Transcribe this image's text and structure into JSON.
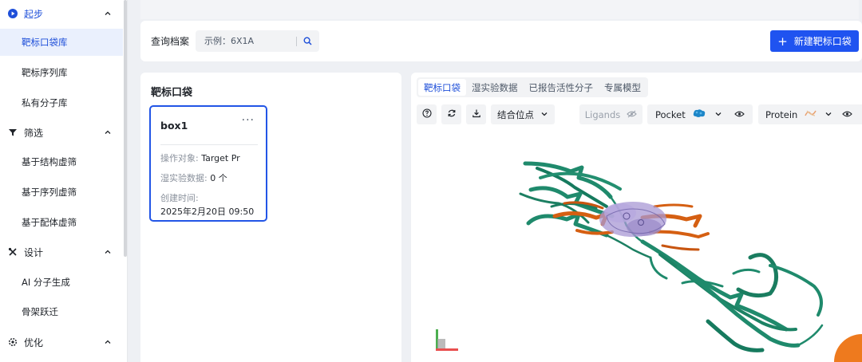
{
  "sidebar": {
    "groups": [
      {
        "label": "起步",
        "icon": "play-circle-icon",
        "active": true,
        "items": [
          {
            "label": "靶标口袋库",
            "active": true
          },
          {
            "label": "靶标序列库"
          },
          {
            "label": "私有分子库"
          }
        ]
      },
      {
        "label": "筛选",
        "icon": "filter-icon",
        "items": [
          {
            "label": "基于结构虚筛"
          },
          {
            "label": "基于序列虚筛"
          },
          {
            "label": "基于配体虚筛"
          }
        ]
      },
      {
        "label": "设计",
        "icon": "design-tools-icon",
        "items": [
          {
            "label": "AI 分子生成"
          },
          {
            "label": "骨架跃迁"
          }
        ]
      },
      {
        "label": "优化",
        "icon": "settings-icon",
        "items": []
      }
    ]
  },
  "search": {
    "label": "查询档案",
    "placeholder": "示例：6X1A",
    "new_button": "新建靶标口袋"
  },
  "pockets": {
    "title": "靶标口袋",
    "cards": [
      {
        "name": "box1",
        "more": "···",
        "target_label": "操作对象:",
        "target_value": "Target Pr",
        "wetlab_label": "湿实验数据:",
        "wetlab_value": "0 个",
        "created_label": "创建时间:",
        "created_value": "2025年2月20日 09:50"
      }
    ]
  },
  "viewer": {
    "tabs": [
      "靶标口袋",
      "湿实验数据",
      "已报告活性分子",
      "专属模型"
    ],
    "active_tab": 0,
    "tools": {
      "help": "help-icon",
      "refresh": "refresh-icon",
      "download": "download-icon",
      "binding_site": "结合位点",
      "ligands": "Ligands",
      "pocket": "Pocket",
      "protein": "Protein"
    }
  },
  "colors": {
    "accent": "#1f53f0",
    "active_text": "#1e4fd9",
    "protein_green": "#1f8a6c",
    "ligand_orange": "#d55f12",
    "pocket_purple": "#9b8ccf",
    "fab_orange": "#ee7a1e"
  }
}
